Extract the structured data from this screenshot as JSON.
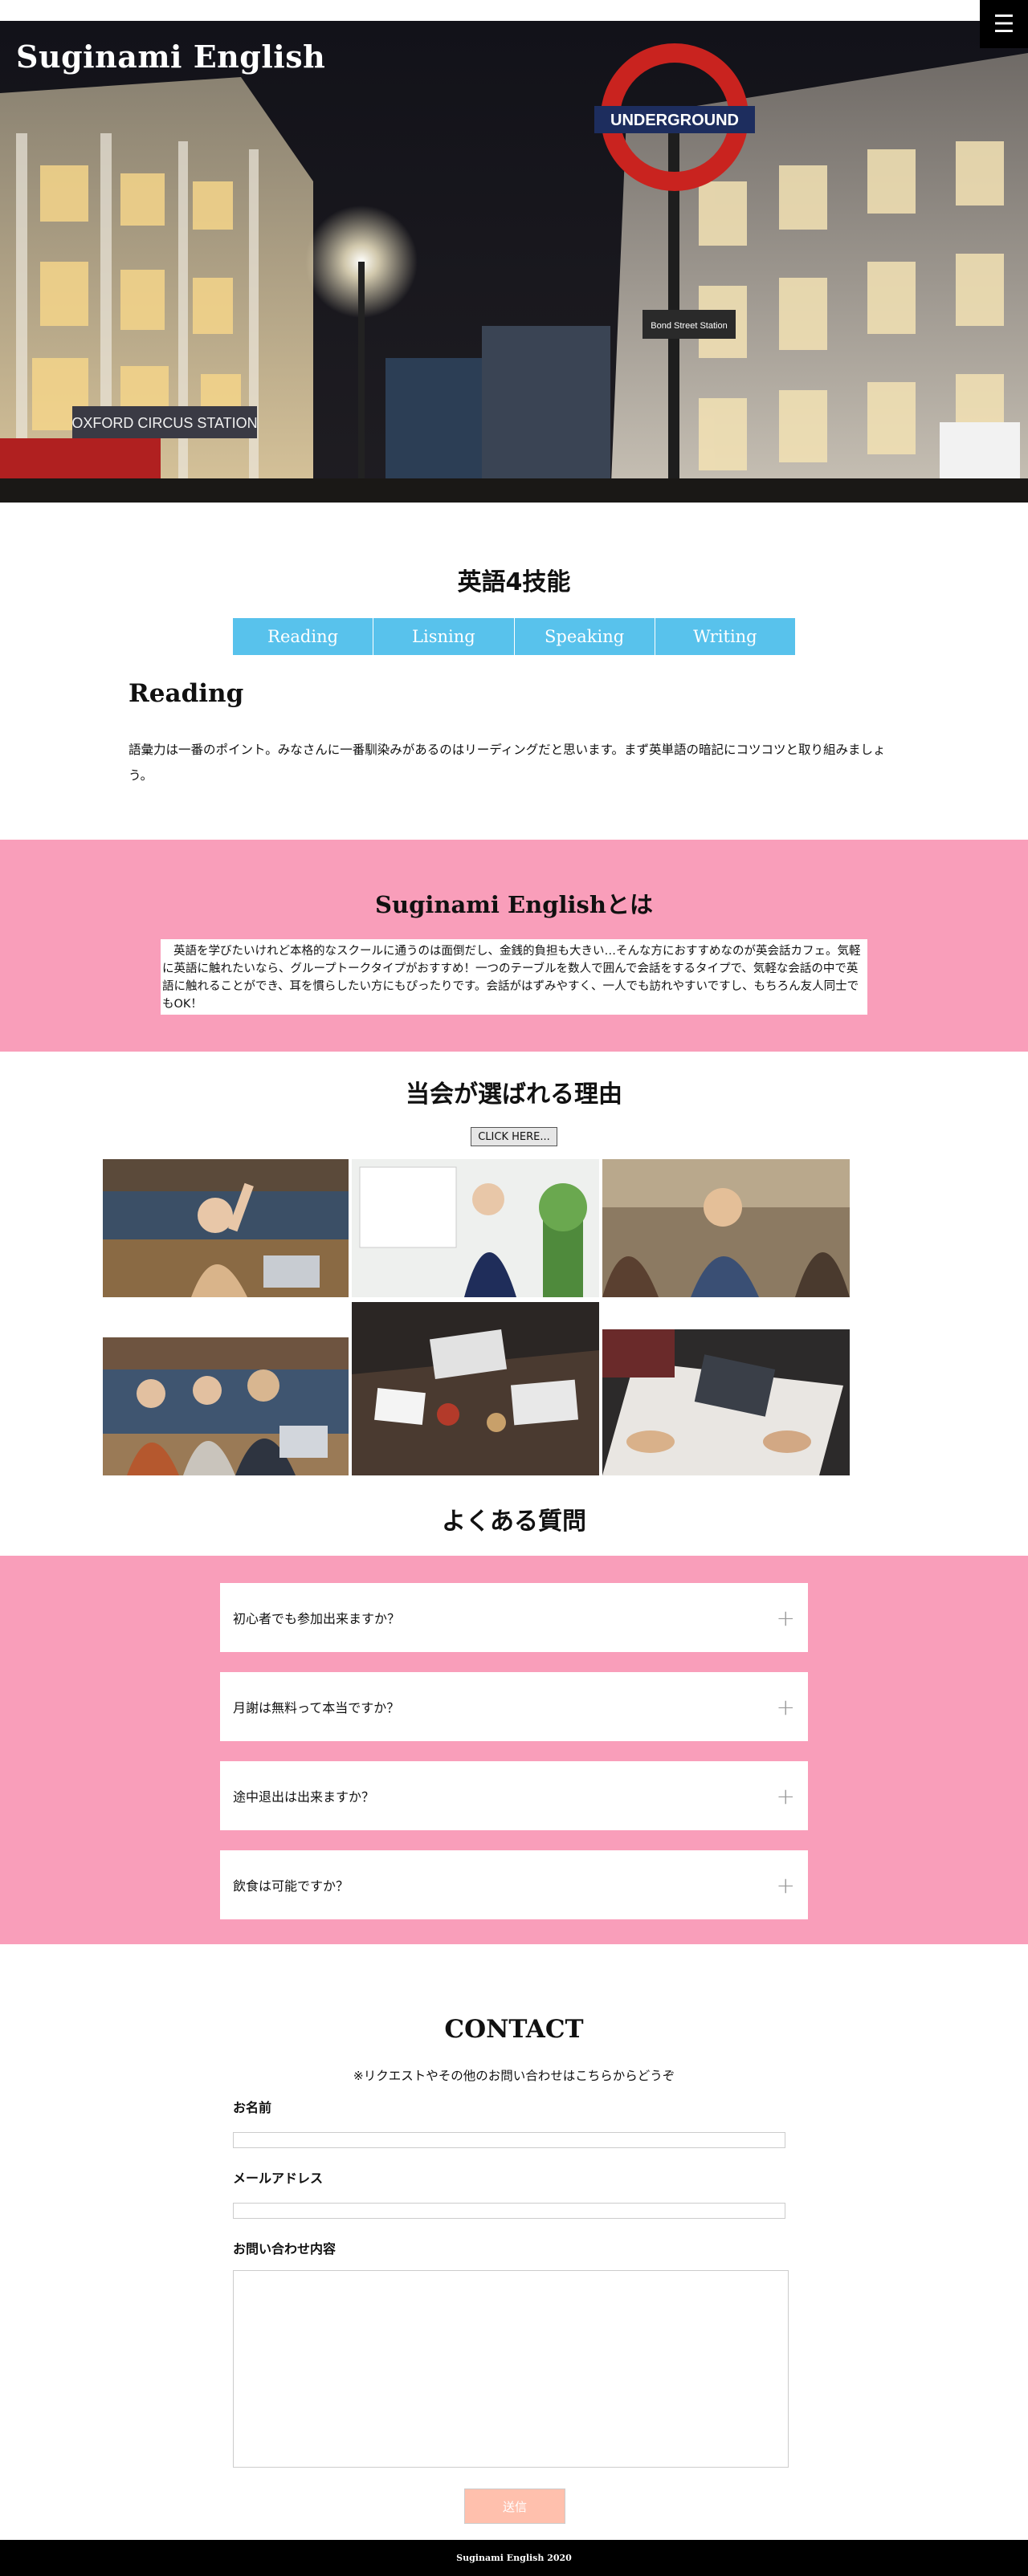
{
  "header": {
    "site_title": "Suginami English",
    "menu_icon": "hamburger-icon",
    "menu_glyph": "☰"
  },
  "hero": {
    "sign_underground": "UNDERGROUND",
    "sign_station": "OXFORD CIRCUS STATION",
    "sign_bond_street": "Bond Street Station"
  },
  "skills": {
    "title": "英語4技能",
    "tabs": [
      "Reading",
      "Lisning",
      "Speaking",
      "Writing"
    ],
    "active_heading": "Reading",
    "active_text": "語彙力は一番のポイント。みなさんに一番馴染みがあるのはリーディングだと思います。まず英単語の暗記にコツコツと取り組みましょう。"
  },
  "about": {
    "title": "Suginami Englishとは",
    "text": "英語を学びたいけれど本格的なスクールに通うのは面倒だし、金銭的負担も大きい…そんな方におすすめなのが英会話カフェ。気軽に英語に触れたいなら、グループトークタイプがおすすめ！一つのテーブルを数人で囲んで会話をするタイプで、気軽な会話の中で英語に触れることができ、耳を慣らしたい方にもぴったりです。会話がはずみやすく、一人でも訪れやすいですし、もちろん友人同士でもOK！"
  },
  "reasons": {
    "title": "当会が選ばれる理由",
    "button_label": "CLICK HERE..."
  },
  "faq": {
    "title": "よくある質問",
    "items": [
      "初心者でも参加出来ますか？",
      "月謝は無料って本当ですか？",
      "途中退出は出来ますか？",
      "飲食は可能ですか？"
    ],
    "expand_glyph": "+"
  },
  "contact": {
    "title": "CONTACT",
    "note": "※リクエストやその他のお問い合わせはこちらからどうぞ",
    "name_label": "お名前",
    "email_label": "メールアドレス",
    "message_label": "お問い合わせ内容",
    "submit_label": "送信"
  },
  "footer": {
    "copyright": "Suginami English 2020"
  },
  "colors": {
    "accent_blue": "#58c2ec",
    "pink": "#f99eba",
    "submit": "#ffc0ad"
  }
}
